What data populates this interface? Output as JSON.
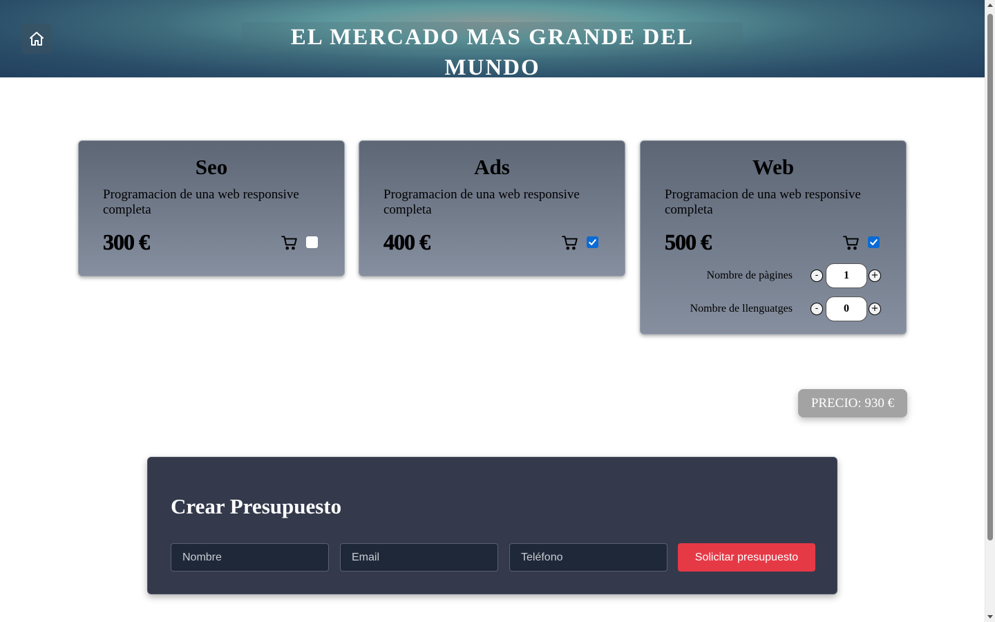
{
  "header": {
    "title": "EL MERCADO MAS GRANDE DEL MUNDO",
    "home_icon": "home-icon"
  },
  "services": [
    {
      "name": "Seo",
      "description": "Programacion de una web responsive completa",
      "price": "300 €",
      "selected": false
    },
    {
      "name": "Ads",
      "description": "Programacion de una web responsive completa",
      "price": "400 €",
      "selected": true
    },
    {
      "name": "Web",
      "description": "Programacion de una web responsive completa",
      "price": "500 €",
      "selected": true,
      "options": [
        {
          "label": "Nombre de pàgines",
          "value": "1",
          "minus": "-",
          "plus": "+"
        },
        {
          "label": "Nombre de llenguatges",
          "value": "0",
          "minus": "-",
          "plus": "+"
        }
      ]
    }
  ],
  "total": {
    "text": "PRECIO: 930 €"
  },
  "budget_form": {
    "title": "Crear Presupuesto",
    "name_placeholder": "Nombre",
    "email_placeholder": "Email",
    "phone_placeholder": "Teléfono",
    "submit_label": "Solicitar presupuesto"
  },
  "colors": {
    "accent": "#e63946",
    "checkbox_checked": "#0b6bd6",
    "form_background": "#343a4c",
    "total_badge": "#a3a3a3"
  }
}
